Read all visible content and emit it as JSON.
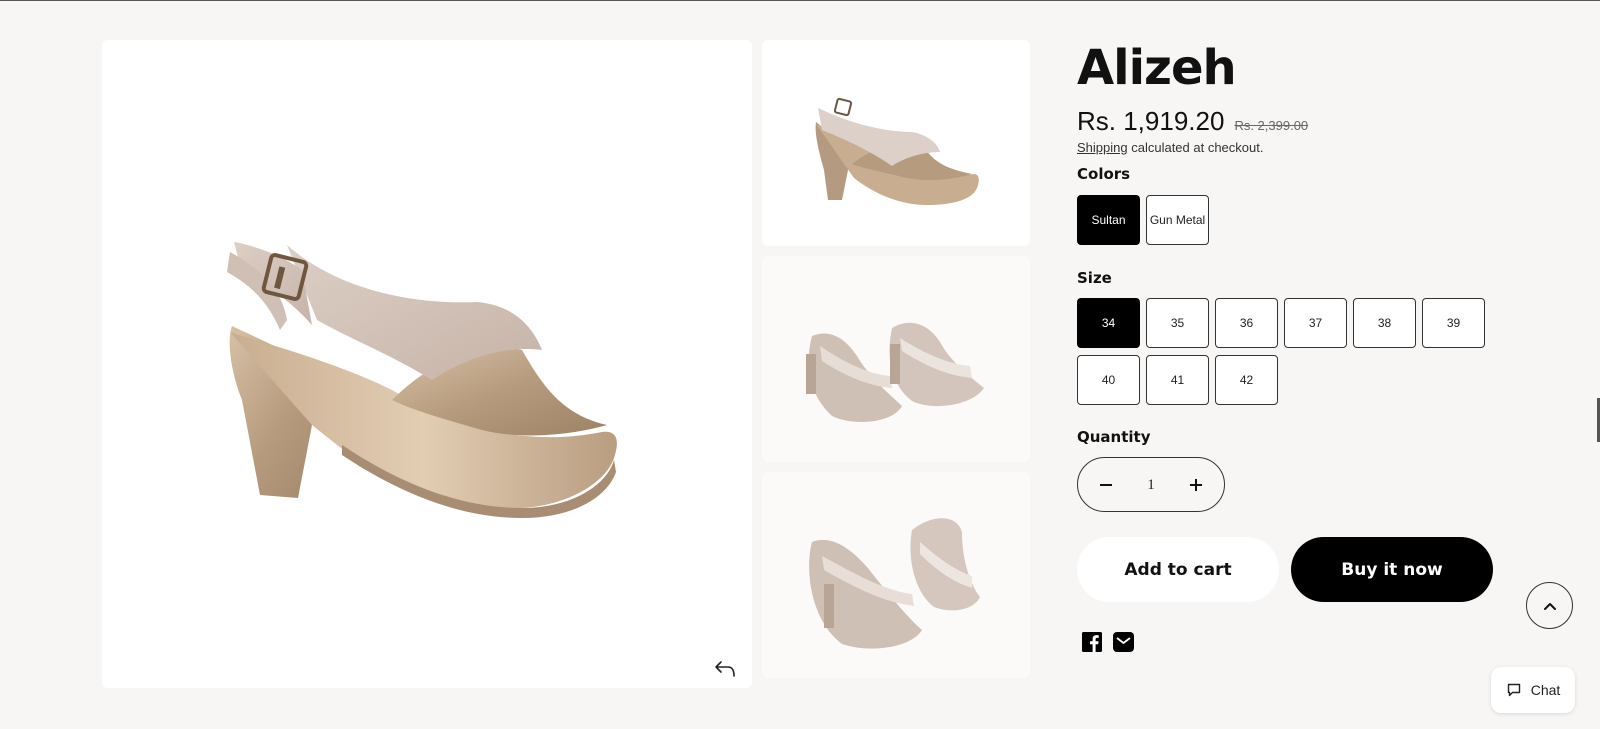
{
  "product": {
    "title": "Alizeh",
    "sale_price": "Rs. 1,919.20",
    "regular_price": "Rs. 2,399.00",
    "shipping_link": "Shipping",
    "shipping_text": " calculated at checkout."
  },
  "colors": {
    "label": "Colors",
    "options": [
      "Sultan",
      "Gun Metal"
    ],
    "selected": "Sultan"
  },
  "size": {
    "label": "Size",
    "options": [
      "34",
      "35",
      "36",
      "37",
      "38",
      "39",
      "40",
      "41",
      "42"
    ],
    "selected": "34"
  },
  "quantity": {
    "label": "Quantity",
    "value": "1",
    "minus_icon": "minus-icon",
    "plus_icon": "plus-icon"
  },
  "actions": {
    "add_to_cart": "Add to cart",
    "buy_now": "Buy it now"
  },
  "share": {
    "facebook_icon": "facebook-icon",
    "email_icon": "email-icon"
  },
  "gallery": {
    "prev_icon": "arrow-prev-icon",
    "next_icon": "arrow-next-icon"
  },
  "chat": {
    "label": "Chat",
    "icon": "chat-bubble-icon"
  },
  "scroll_top": {
    "icon": "chevron-up-icon"
  },
  "colors_theme": {
    "background": "#f7f6f4",
    "primary": "#000000",
    "surface": "#ffffff"
  }
}
